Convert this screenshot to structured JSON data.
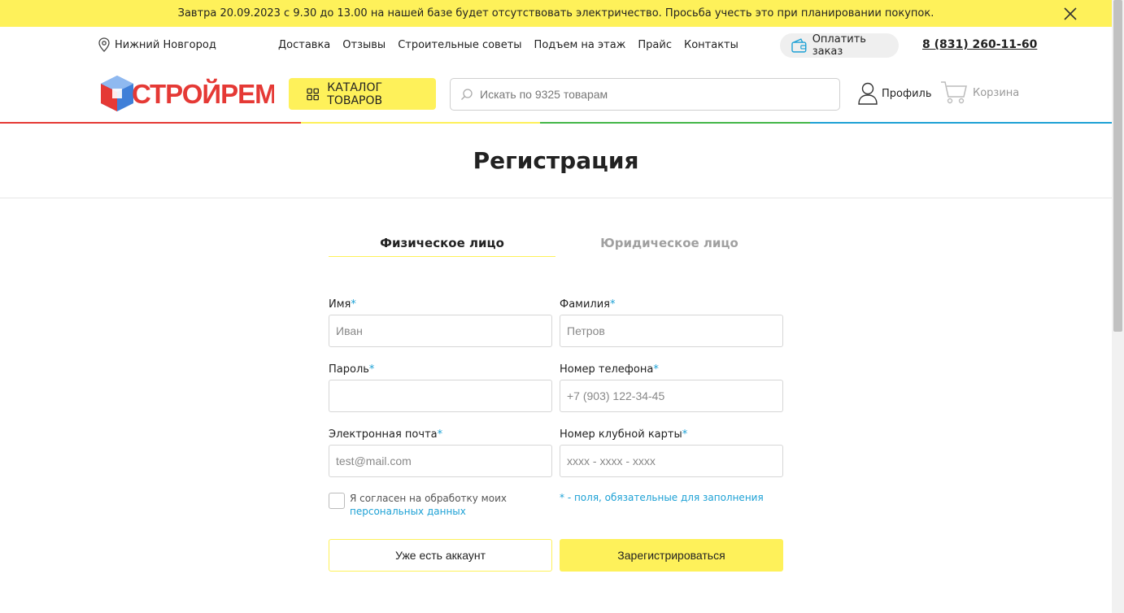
{
  "notice": {
    "text": "Завтра 20.09.2023 с 9.30 до 13.00 на нашей базе будет отсутствовать электричество. Просьба учесть это при планировании покупок."
  },
  "topline": {
    "city": "Нижний Новгород",
    "nav": [
      "Доставка",
      "Отзывы",
      "Строительные советы",
      "Подъем на этаж",
      "Прайс",
      "Контакты"
    ],
    "pay_label": "Оплатить заказ",
    "phone": "8 (831) 260-11-60"
  },
  "header": {
    "logo_text": "СТРОЙРЕМ",
    "catalog_label": "КАТАЛОГ ТОВАРОВ",
    "search_placeholder": "Искать по 9325 товарам",
    "profile_label": "Профиль",
    "cart_label": "Корзина"
  },
  "colors": {
    "accent_yellow": "#fef15a",
    "link_blue": "#1da1d5",
    "line_red": "#e53935",
    "line_yellow": "#fef15a",
    "line_green": "#43b649",
    "line_blue": "#1da1d5"
  },
  "page_title": "Регистрация",
  "tabs": [
    {
      "label": "Физическое лицо",
      "active": true
    },
    {
      "label": "Юридическое лицо",
      "active": false
    }
  ],
  "form": {
    "required_mark": "*",
    "first_name": {
      "label": "Имя",
      "placeholder": "Иван",
      "value": ""
    },
    "last_name": {
      "label": "Фамилия",
      "placeholder": "Петров",
      "value": ""
    },
    "password": {
      "label": "Пароль",
      "placeholder": "",
      "value": ""
    },
    "phone": {
      "label": "Номер телефона",
      "placeholder": "+7 (903) 122-34-45",
      "value": ""
    },
    "email": {
      "label": "Электронная почта",
      "placeholder": "test@mail.com",
      "value": ""
    },
    "card": {
      "label": "Номер клубной карты",
      "placeholder": "xxxx - xxxx - xxxx",
      "value": ""
    },
    "agree_text": "Я согласен на обработку моих",
    "agree_link": "персональных данных",
    "required_note": "* - поля, обязательные для заполнения",
    "login_button": "Уже есть аккаунт",
    "register_button": "Зарегистрироваться"
  }
}
